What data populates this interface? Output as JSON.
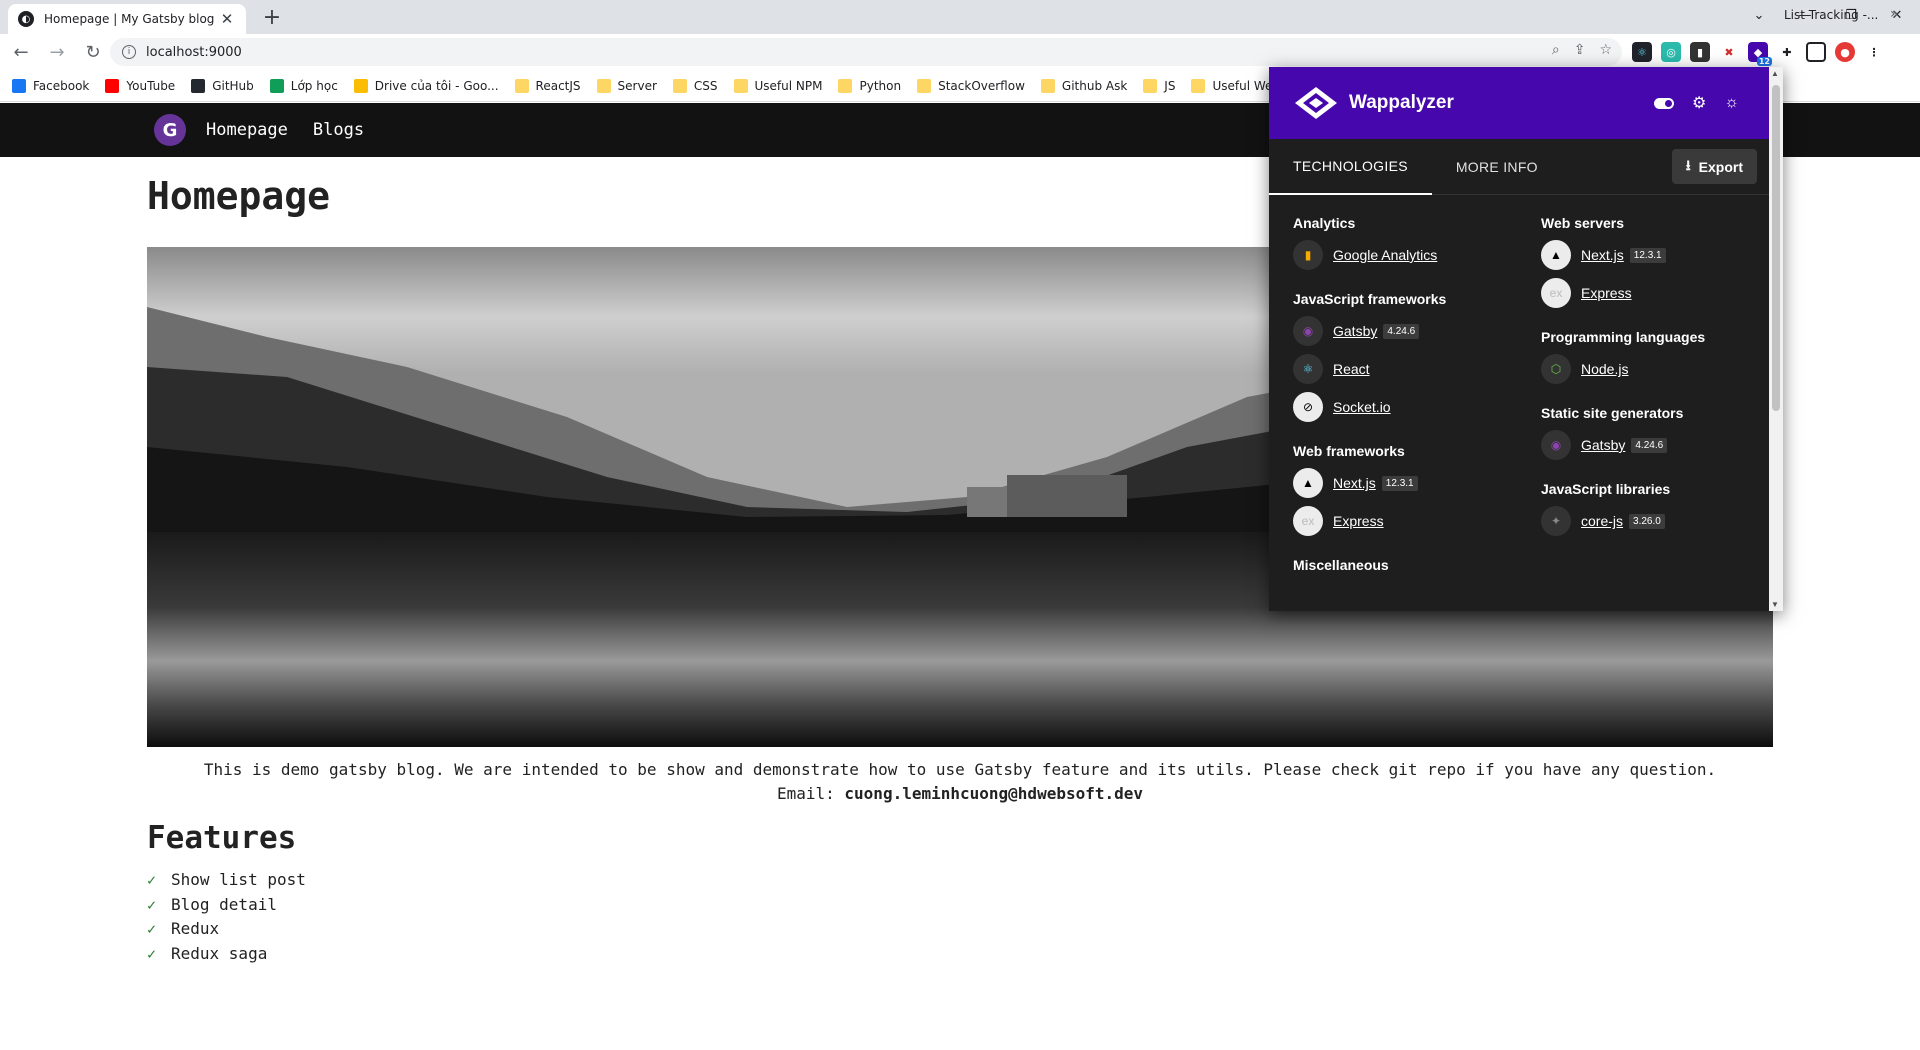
{
  "browser": {
    "tab_title": "Homepage | My Gatsby blog",
    "tab_close": "✕",
    "new_tab": "+",
    "url": "localhost:9000",
    "window_controls": [
      "⌄",
      "—",
      "❐",
      "✕"
    ],
    "bookmarks": [
      {
        "label": "Facebook",
        "icon": "facebook-icon",
        "color": "#1877f2"
      },
      {
        "label": "YouTube",
        "icon": "youtube-icon",
        "color": "#ff0000"
      },
      {
        "label": "GitHub",
        "icon": "github-icon",
        "color": "#24292f"
      },
      {
        "label": "Lớp học",
        "icon": "classroom-icon",
        "color": "#0f9d58"
      },
      {
        "label": "Drive của tôi - Goo...",
        "icon": "drive-icon",
        "color": "#fbbc04"
      },
      {
        "label": "ReactJS",
        "icon": "folder-icon"
      },
      {
        "label": "Server",
        "icon": "folder-icon"
      },
      {
        "label": "CSS",
        "icon": "folder-icon"
      },
      {
        "label": "Useful NPM",
        "icon": "folder-icon"
      },
      {
        "label": "Python",
        "icon": "folder-icon"
      },
      {
        "label": "StackOverflow",
        "icon": "folder-icon"
      },
      {
        "label": "Github Ask",
        "icon": "folder-icon"
      },
      {
        "label": "JS",
        "icon": "folder-icon"
      },
      {
        "label": "Useful Website",
        "icon": "folder-icon"
      }
    ],
    "bookmark_right": "List Tracking -...",
    "bookmark_more": "»",
    "extension_badge": "12"
  },
  "site": {
    "nav": {
      "home": "Homepage",
      "blogs": "Blogs",
      "logo": "G"
    },
    "title": "Homepage",
    "intro_line1": "This is demo gatsby blog. We are intended to be show and demonstrate how to use Gatsby feature and its utils. Please check git repo if you have any question.",
    "email_label": "Email:",
    "email": "cuong.leminhcuong@hdwebsoft.dev",
    "features_title": "Features",
    "features": [
      "Show list post",
      "Blog detail",
      "Redux",
      "Redux saga"
    ]
  },
  "wappalyzer": {
    "name": "Wappalyzer",
    "brand_color": "#4608ad",
    "tabs": {
      "technologies": "TECHNOLOGIES",
      "more_info": "MORE INFO"
    },
    "export": "Export",
    "left": [
      {
        "category": "Analytics",
        "techs": [
          {
            "name": "Google Analytics",
            "version": "",
            "icon": "google-analytics-icon"
          }
        ]
      },
      {
        "category": "JavaScript frameworks",
        "techs": [
          {
            "name": "Gatsby",
            "version": "4.24.6",
            "icon": "gatsby-icon"
          },
          {
            "name": "React",
            "version": "",
            "icon": "react-icon"
          },
          {
            "name": "Socket.io",
            "version": "",
            "icon": "socketio-icon"
          }
        ]
      },
      {
        "category": "Web frameworks",
        "techs": [
          {
            "name": "Next.js",
            "version": "12.3.1",
            "icon": "nextjs-icon"
          },
          {
            "name": "Express",
            "version": "",
            "icon": "express-icon"
          }
        ]
      },
      {
        "category": "Miscellaneous",
        "techs": []
      }
    ],
    "right": [
      {
        "category": "Web servers",
        "techs": [
          {
            "name": "Next.js",
            "version": "12.3.1",
            "icon": "nextjs-icon"
          },
          {
            "name": "Express",
            "version": "",
            "icon": "express-icon"
          }
        ]
      },
      {
        "category": "Programming languages",
        "techs": [
          {
            "name": "Node.js",
            "version": "",
            "icon": "nodejs-icon"
          }
        ]
      },
      {
        "category": "Static site generators",
        "techs": [
          {
            "name": "Gatsby",
            "version": "4.24.6",
            "icon": "gatsby-icon"
          }
        ]
      },
      {
        "category": "JavaScript libraries",
        "techs": [
          {
            "name": "core-js",
            "version": "3.26.0",
            "icon": "corejs-icon"
          }
        ]
      }
    ]
  }
}
